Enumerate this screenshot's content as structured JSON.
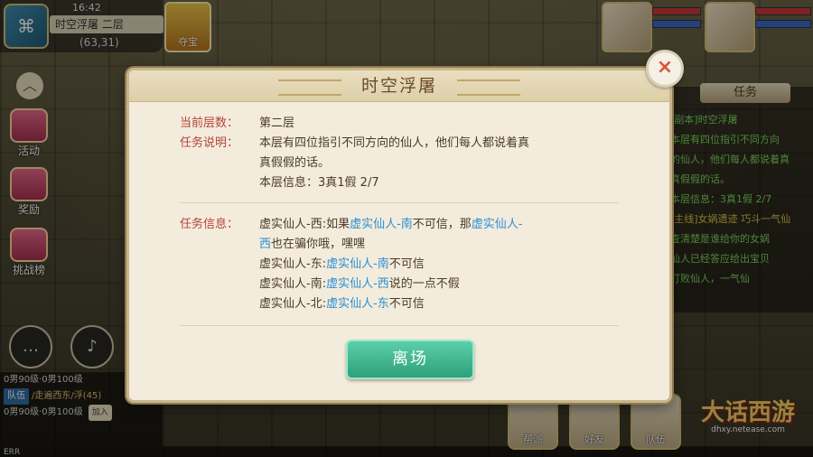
{
  "hud": {
    "time": "16:42",
    "location_name": "时空浮屠 二层",
    "coords": "(63,31)",
    "duobao_label": "夺宝",
    "side_buttons": [
      "活动",
      "奖励",
      "挑战榜"
    ],
    "chat": {
      "line1": "0男90级·0男100级",
      "team_tag": "队伍",
      "line2": "/走遍西东/浮(45)",
      "line3": "0男90级·0男100级",
      "add_label": "加入"
    },
    "bottom_tag": "ERR",
    "quest_tab": "任务",
    "quest_lines": [
      {
        "text": "[副本]时空浮屠",
        "cls": "qt-green"
      },
      {
        "text": "本层有四位指引不同方向",
        "cls": "qt-green"
      },
      {
        "text": "的仙人，他们每人都说着真",
        "cls": "qt-green"
      },
      {
        "text": "真假假的话。",
        "cls": "qt-green"
      },
      {
        "text": "本层信息：3真1假 2/7",
        "cls": "qt-green"
      },
      {
        "text": "[主线]女娲遗迹 巧斗一气仙",
        "cls": "qt-yellow"
      },
      {
        "text": "查清楚是谁给你的女娲",
        "cls": "qt-green"
      },
      {
        "text": "仙人已经答应给出宝贝",
        "cls": "qt-green"
      },
      {
        "text": "打败仙人，一气仙",
        "cls": "qt-green"
      }
    ],
    "bottom_buttons": [
      "帮派",
      "好友",
      "队伍"
    ],
    "logo_title": "大话西游",
    "logo_sub": "dhxy.netease.com"
  },
  "dialog": {
    "title": "时空浮屠",
    "close_icon": "×",
    "floor_label": "当前层数：",
    "floor_value": "第二层",
    "desc_label": "任务说明：",
    "desc_line1": "本层有四位指引不同方向的仙人，他们每人都说着真",
    "desc_line2": "真假假的话。",
    "info_line": "本层信息：3真1假 2/7",
    "task_label": "任务信息：",
    "clues": [
      {
        "a": "虚实仙人-西:如果",
        "b": "虚实仙人-南",
        "c": "不可信，那",
        "d": "虚实仙人-"
      },
      {
        "a": "西",
        "b": "",
        "c": "也在骗你哦，嘿嘿",
        "d": ""
      },
      {
        "a": "虚实仙人-东:",
        "b": "虚实仙人-南",
        "c": "不可信",
        "d": ""
      },
      {
        "a": "虚实仙人-南:",
        "b": "虚实仙人-西",
        "c": "说的一点不假",
        "d": ""
      },
      {
        "a": "虚实仙人-北:",
        "b": "虚实仙人-东",
        "c": "不可信",
        "d": ""
      }
    ],
    "leave_label": "离场"
  },
  "colors": {
    "label_red": "#b5423a",
    "highlight_blue": "#2e8fd6",
    "button_green": "#2fa07a"
  }
}
